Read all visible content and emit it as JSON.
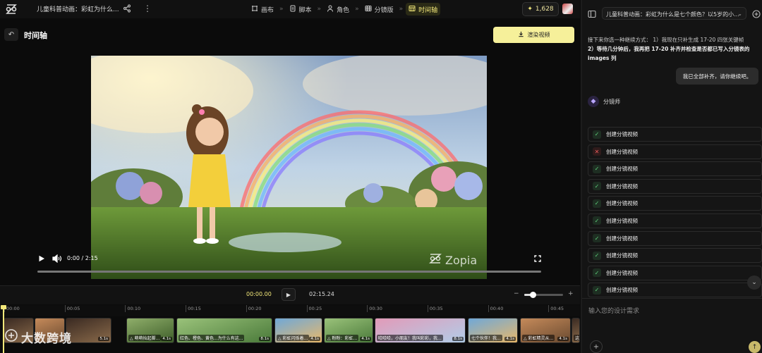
{
  "header": {
    "project_title": "儿童科普动画：彩虹为什么...",
    "tabs": [
      {
        "label": "画布",
        "icon": "canvas-icon"
      },
      {
        "label": "脚本",
        "icon": "document-icon"
      },
      {
        "label": "角色",
        "icon": "person-icon"
      },
      {
        "label": "分镜版",
        "icon": "film-icon"
      },
      {
        "label": "时间轴",
        "icon": "timeline-icon",
        "active": true
      }
    ],
    "separator": "»",
    "credits": "1,628"
  },
  "subheader": {
    "back_icon": "undo-icon",
    "title": "时间轴",
    "render_button": "渲染视频"
  },
  "player": {
    "time": "0:00 / 2:15",
    "watermark": "Zopia",
    "progress": 0.0
  },
  "timeline": {
    "current_time": "00:00.00",
    "total_time": "02:15.24",
    "zoom_level": 0.22,
    "ruler_ticks": [
      "00:00",
      "00:05",
      "00:10",
      "00:15",
      "00:20",
      "00:25",
      "00:30",
      "00:35",
      "00:40",
      "00:45"
    ],
    "clips": [
      {
        "caption": "",
        "duration": "",
        "palette": "room"
      },
      {
        "caption": "",
        "duration": "",
        "palette": "girl"
      },
      {
        "caption": "",
        "duration": "5.1s",
        "palette": "room"
      },
      {
        "caption": "△ 萌萌抬起脚...",
        "duration": "4.1s",
        "palette": "field"
      },
      {
        "caption": "红色、橙色、黄色...为什么有这...",
        "duration": "8.1s",
        "palette": "garden"
      },
      {
        "caption": "△ 彩虹闪烁着...",
        "duration": "4.1s",
        "palette": "rainbow"
      },
      {
        "caption": "△ 粉粉：彩虹...",
        "duration": "4.1s",
        "palette": "garden"
      },
      {
        "caption": "哈哈哈，小朋友！我叫彩彩，我...",
        "duration": "8.1s",
        "palette": "pink"
      },
      {
        "caption": "七个伙伴！我...",
        "duration": "4.1s",
        "palette": "rainbow"
      },
      {
        "caption": "△ 彩虹精灵从...",
        "duration": "4.1s",
        "palette": "girl"
      },
      {
        "caption": "这",
        "duration": "",
        "palette": "room"
      }
    ],
    "corner_watermark": "大数跨境"
  },
  "chat": {
    "title": "儿童科普动画：彩虹为什么是七个颜色？以5岁的小...",
    "faded_text": "",
    "ai_message_plain": "接下来你选一种继续方式： 1）我现在只补生成 17-20 四张关键帧 2）等待几分钟后，我再把 17-20 补齐并检查是否都已写入分镜表的 images 列",
    "ai_message_p1": "接下来你选一种继续方式： 1）我现在只补生成 17-20 四张关键帧",
    "ai_message_p2": "2）等待几分钟后，我再把 17-20 补齐并检查是否都已写入分镜表的 images 列",
    "user_message": "我已全部补齐，请你继续吧。",
    "agent_name": "分镜师",
    "tasks": [
      {
        "label": "创建分镜视频",
        "status": "success"
      },
      {
        "label": "创建分镜视频",
        "status": "error"
      },
      {
        "label": "创建分镜视频",
        "status": "success"
      },
      {
        "label": "创建分镜视频",
        "status": "success"
      },
      {
        "label": "创建分镜视频",
        "status": "success"
      },
      {
        "label": "创建分镜视频",
        "status": "success"
      },
      {
        "label": "创建分镜视频",
        "status": "success"
      },
      {
        "label": "创建分镜视频",
        "status": "success"
      },
      {
        "label": "创建分镜视频",
        "status": "success"
      },
      {
        "label": "创建分镜视频",
        "status": "success"
      }
    ],
    "input_placeholder": "输入您的设计需求"
  },
  "colors": {
    "accent": "#f6f09a",
    "success": "#5fd07b",
    "error": "#ef5b5b",
    "background": "#0b0b0b"
  }
}
